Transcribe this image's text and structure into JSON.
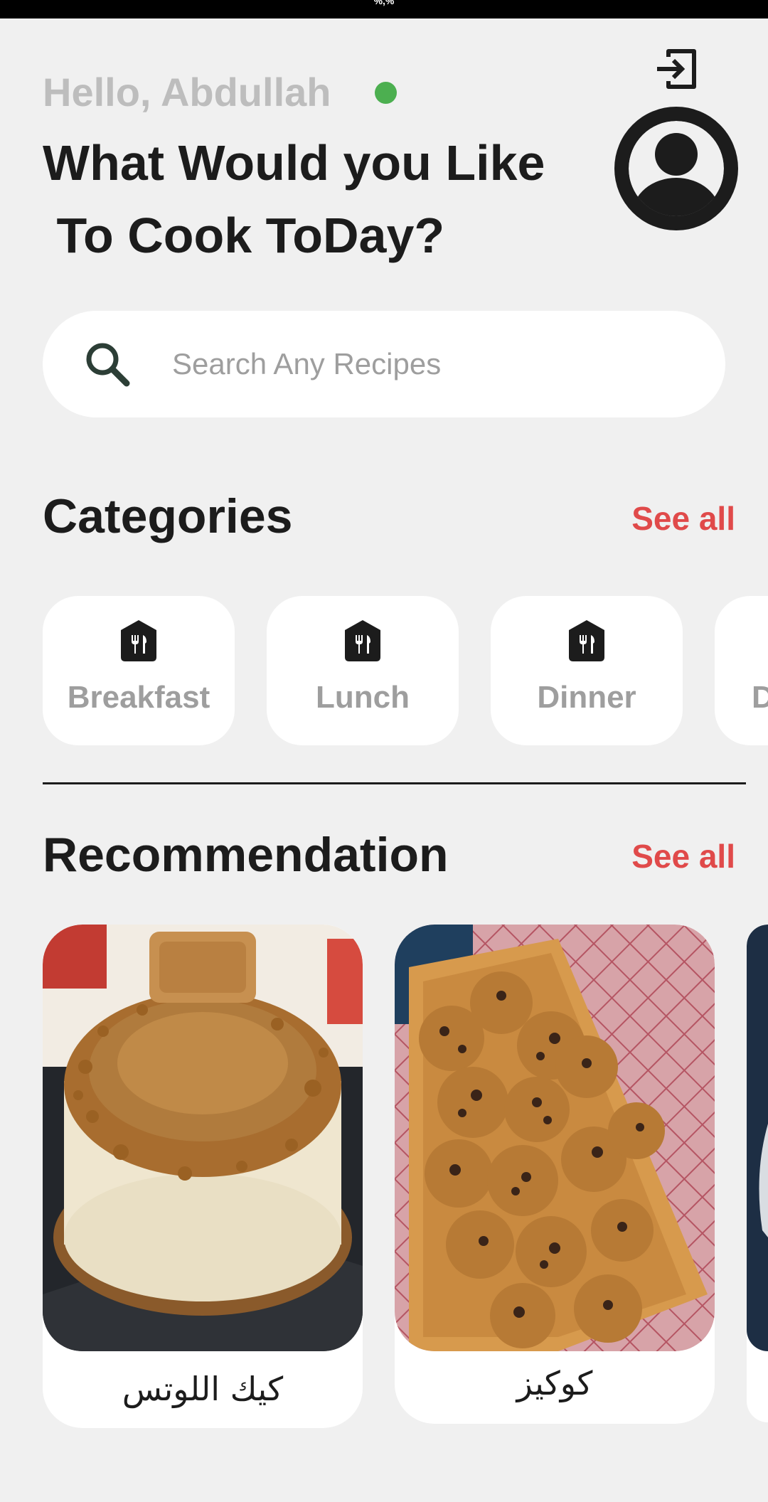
{
  "status_bar": {
    "text": "%,%"
  },
  "header": {
    "greeting": "Hello, Abdullah",
    "online_color": "#4caf50",
    "headline": "What Would you Like\n To Cook ToDay?",
    "logout_icon": "logout-icon",
    "avatar_icon": "account-circle-icon"
  },
  "search": {
    "placeholder": "Search Any Recipes",
    "value": "",
    "icon": "search-icon"
  },
  "categories": {
    "title": "Categories",
    "see_all": "See all",
    "items": [
      {
        "label": "Breakfast",
        "icon": "restaurant-icon"
      },
      {
        "label": "Lunch",
        "icon": "restaurant-icon"
      },
      {
        "label": "Dinner",
        "icon": "restaurant-icon"
      },
      {
        "label": "D",
        "icon": "restaurant-icon"
      }
    ]
  },
  "recommendation": {
    "title": "Recommendation",
    "see_all": "See all",
    "items": [
      {
        "name": "كيك اللوتس"
      },
      {
        "name": "كوكيز"
      },
      {
        "name": ""
      }
    ]
  },
  "colors": {
    "background": "#f0f0f0",
    "accent": "#e04a4a",
    "card": "#ffffff",
    "muted_text": "#9e9e9e",
    "dark_text": "#1c1c1c"
  }
}
